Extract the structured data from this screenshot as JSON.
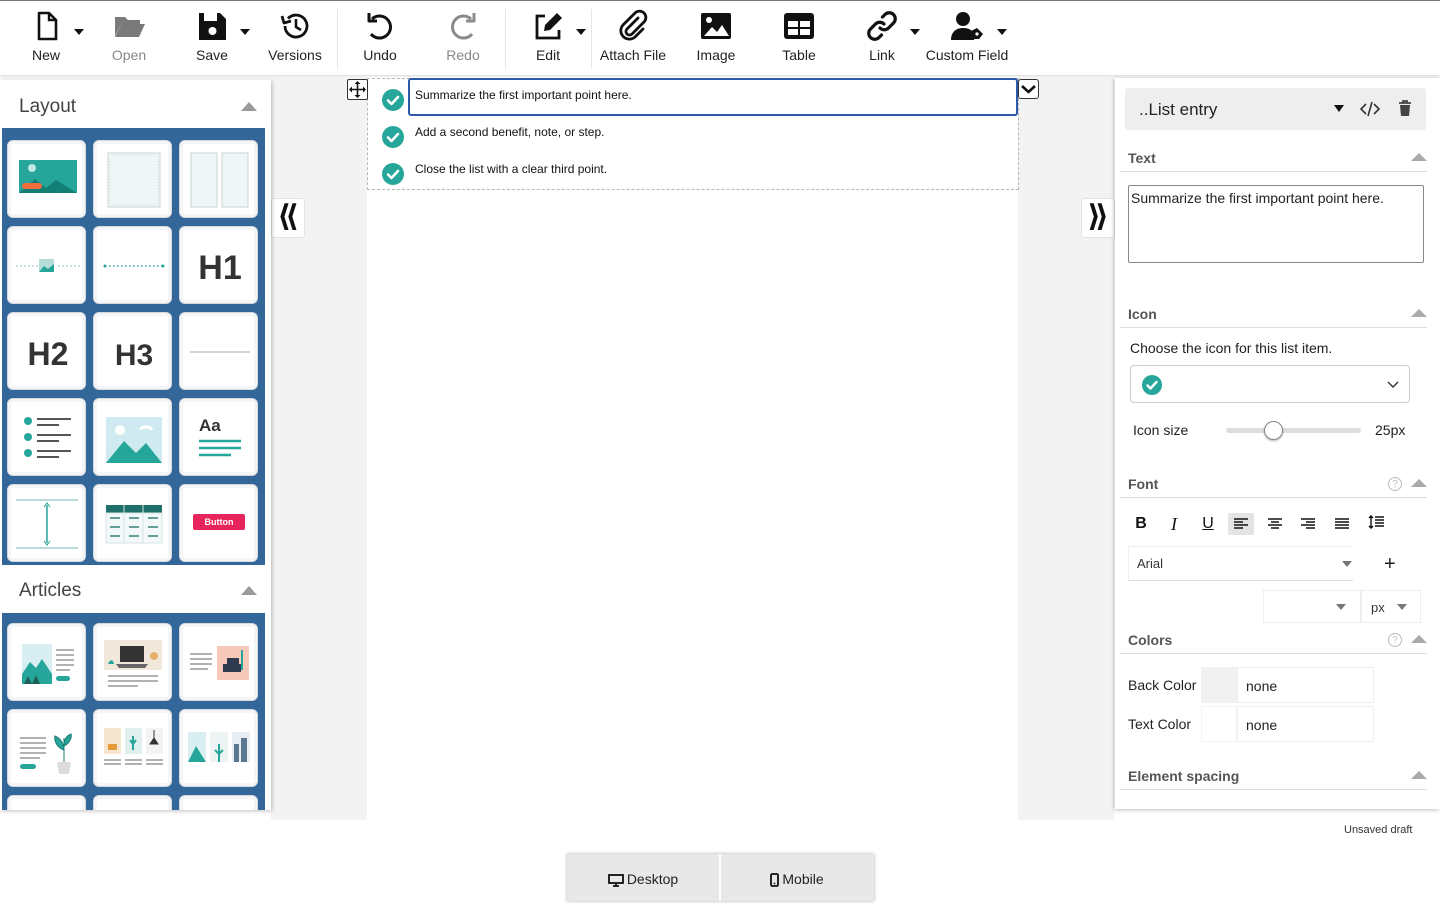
{
  "toolbar": {
    "new": "New",
    "open": "Open",
    "save": "Save",
    "versions": "Versions",
    "undo": "Undo",
    "redo": "Redo",
    "edit": "Edit",
    "attach": "Attach File",
    "image": "Image",
    "table": "Table",
    "link": "Link",
    "custom_field": "Custom Field"
  },
  "left_panel": {
    "layout_title": "Layout",
    "articles_title": "Articles",
    "layout_tiles": [
      "image-banner",
      "container",
      "two-columns",
      "image-divider",
      "dotted-divider",
      "H1",
      "H2",
      "H3",
      "line-divider",
      "checklist",
      "image",
      "text",
      "spacer",
      "table",
      "button"
    ],
    "h1_label": "H1",
    "h2_label": "H2",
    "h3_label": "H3",
    "text_tile_label": "Aa",
    "button_tile_label": "Button"
  },
  "canvas": {
    "list_items": [
      "Summarize the first important point here.",
      "Add a second benefit, note, or step.",
      "Close the list with a clear third point."
    ]
  },
  "right_panel": {
    "element_name": "..List entry",
    "text_section": "Text",
    "text_value": "Summarize the first important point here.",
    "icon_section": "Icon",
    "icon_help": "Choose the icon for this list item.",
    "icon_size_label": "Icon size",
    "icon_size_value": "25px",
    "icon_size_fraction": 0.35,
    "font_section": "Font",
    "font_family": "Arial",
    "font_unit": "px",
    "colors_section": "Colors",
    "back_color_label": "Back Color",
    "back_color_value": "none",
    "text_color_label": "Text Color",
    "text_color_value": "none",
    "spacing_section": "Element spacing"
  },
  "status": "Unsaved draft",
  "view": {
    "desktop": "Desktop",
    "mobile": "Mobile"
  },
  "colors": {
    "accent_teal": "#26a69a",
    "panel_blue": "#336699",
    "selection_blue": "#2d5aa8",
    "button_pink": "#e8245c"
  }
}
